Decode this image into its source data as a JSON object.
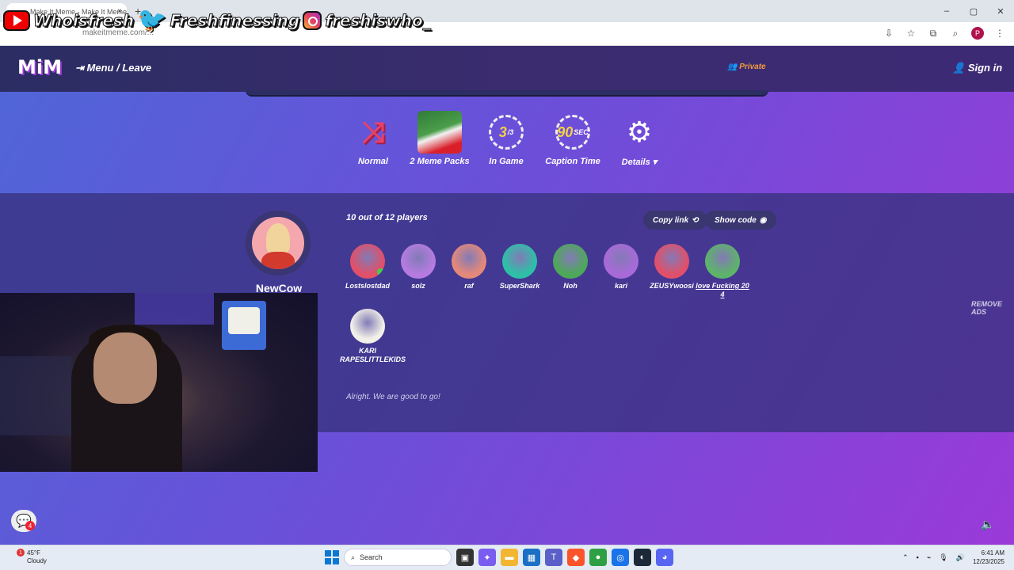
{
  "browser": {
    "tab_title": "Make It Meme - Make It Meme",
    "tab_close": "×",
    "new_tab": "+",
    "url": "makeitmeme.com/...",
    "window_controls": [
      "–",
      "▢",
      "✕"
    ],
    "profile_initial": "P"
  },
  "overlay": {
    "youtube": "Whoisfresh",
    "twitter": "Freshfinessing",
    "instagram": "freshiswho_"
  },
  "header": {
    "logo": "MiM",
    "menu_leave": "Menu / Leave",
    "private_label": "Private",
    "sign_in": "Sign in"
  },
  "settings": {
    "mode": "Normal",
    "packs": "2 Meme Packs",
    "rounds_value": "3",
    "rounds_total": "/3",
    "rounds_label": "In Game",
    "caption_seconds": "90",
    "caption_unit": "SEC",
    "caption_label": "Caption Time",
    "details": "Details"
  },
  "lobby": {
    "host_name": "NewCow",
    "count_text": "10 out of  12 players",
    "copy_link": "Copy link",
    "show_code": "Show code",
    "status": "Alright. We are good to go!",
    "remove_ads": "REMOVE ADS",
    "players": [
      {
        "name": "Lostslostdad",
        "color": "#e0506a",
        "online": true
      },
      {
        "name": "solz",
        "color": "#b57be0",
        "online": false
      },
      {
        "name": "raf",
        "color": "#e4887a",
        "online": false
      },
      {
        "name": "SuperShark",
        "color": "#2fbfa8",
        "online": false
      },
      {
        "name": "Noh",
        "color": "#4ea85a",
        "online": false
      },
      {
        "name": "kari",
        "color": "#a86ad8",
        "online": false
      },
      {
        "name": "ZEUSYwoosi",
        "color": "#e0506a",
        "online": false
      },
      {
        "name": "love Fucking 20 4",
        "color": "#5db36a",
        "online": false
      },
      {
        "name": "KARI RAPESLITTLEKIDS",
        "color": "#f2f0e8",
        "online": false
      }
    ]
  },
  "chat": {
    "badge": "4"
  },
  "taskbar": {
    "weather_badge": "1",
    "temperature": "45°F",
    "condition": "Cloudy",
    "search_placeholder": "Search",
    "time": "6:41 AM",
    "date": "12/23/2025"
  },
  "colors": {
    "accent_private": "#f39c3d",
    "online_dot": "#3ed34a"
  }
}
